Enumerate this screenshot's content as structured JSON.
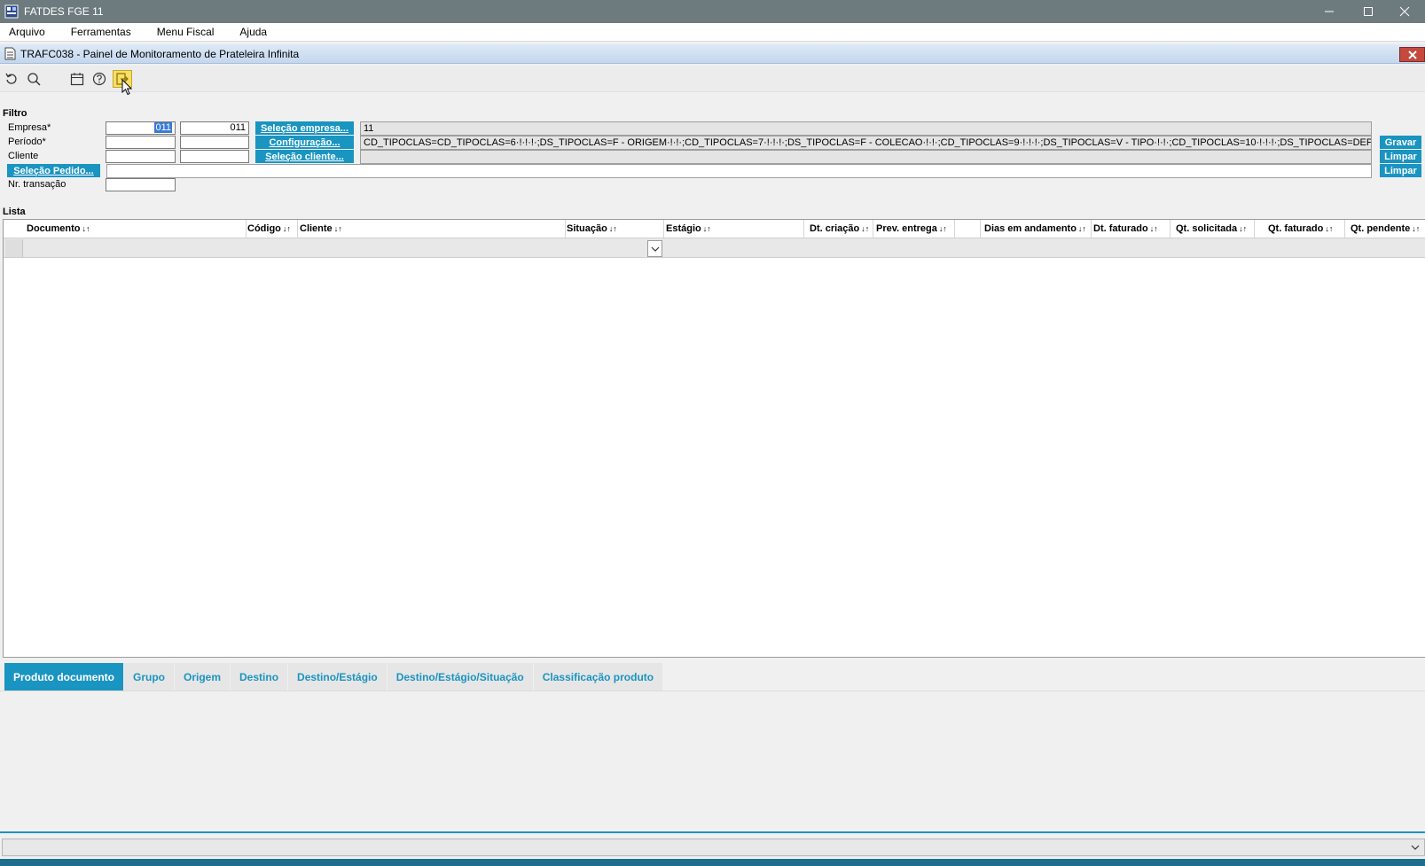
{
  "window": {
    "title": "FATDES FGE 11"
  },
  "menu": {
    "items": [
      "Arquivo",
      "Ferramentas",
      "Menu Fiscal",
      "Ajuda"
    ]
  },
  "form": {
    "title": "TRAFC038 - Painel de Monitoramento de Prateleira Infinita"
  },
  "filtro": {
    "section_label": "Filtro",
    "empresa_label": "Empresa*",
    "periodo_label": "Período*",
    "cliente_label": "Cliente",
    "nr_transacao_label": "Nr. transação",
    "empresa_from": "011",
    "empresa_to": "011",
    "selecao_empresa_btn": "Seleção empresa...",
    "configuracao_btn": "Configuração...",
    "selecao_cliente_btn": "Seleção cliente...",
    "selecao_pedido_btn": "Seleção Pedido...",
    "empresa_list_value": "11",
    "config_value": "CD_TIPOCLAS=CD_TIPOCLAS=6·!·!·!·;DS_TIPOCLAS=F - ORIGEM·!·!·;CD_TIPOCLAS=7·!·!·!·;DS_TIPOCLAS=F - COLECAO·!·!·;CD_TIPOCLAS=9·!·!·!·;DS_TIPOCLAS=V - TIPO·!·!·;CD_TIPOCLAS=10·!·!·!·;DS_TIPOCLAS=DEPARTAMENTO·!·!·;(",
    "gravar_btn": "Gravar",
    "limpar_btn_1": "Limpar",
    "limpar_btn_2": "Limpar"
  },
  "lista": {
    "section_label": "Lista",
    "columns": [
      "Documento",
      "Código",
      "Cliente",
      "Situação",
      "Estágio",
      "Dt. criação",
      "Prev. entrega",
      "Dias em andamento",
      "Dt. faturado",
      "Qt. solicitada",
      "Qt. faturado",
      "Qt. pendente"
    ],
    "sort_glyph": "↓↑"
  },
  "tabs": [
    "Produto documento",
    "Grupo",
    "Origem",
    "Destino",
    "Destino/Estágio",
    "Destino/Estágio/Situação",
    "Classificação produto"
  ],
  "colors": {
    "accent": "#1a94c1",
    "titlebar": "#6d7b7f"
  }
}
